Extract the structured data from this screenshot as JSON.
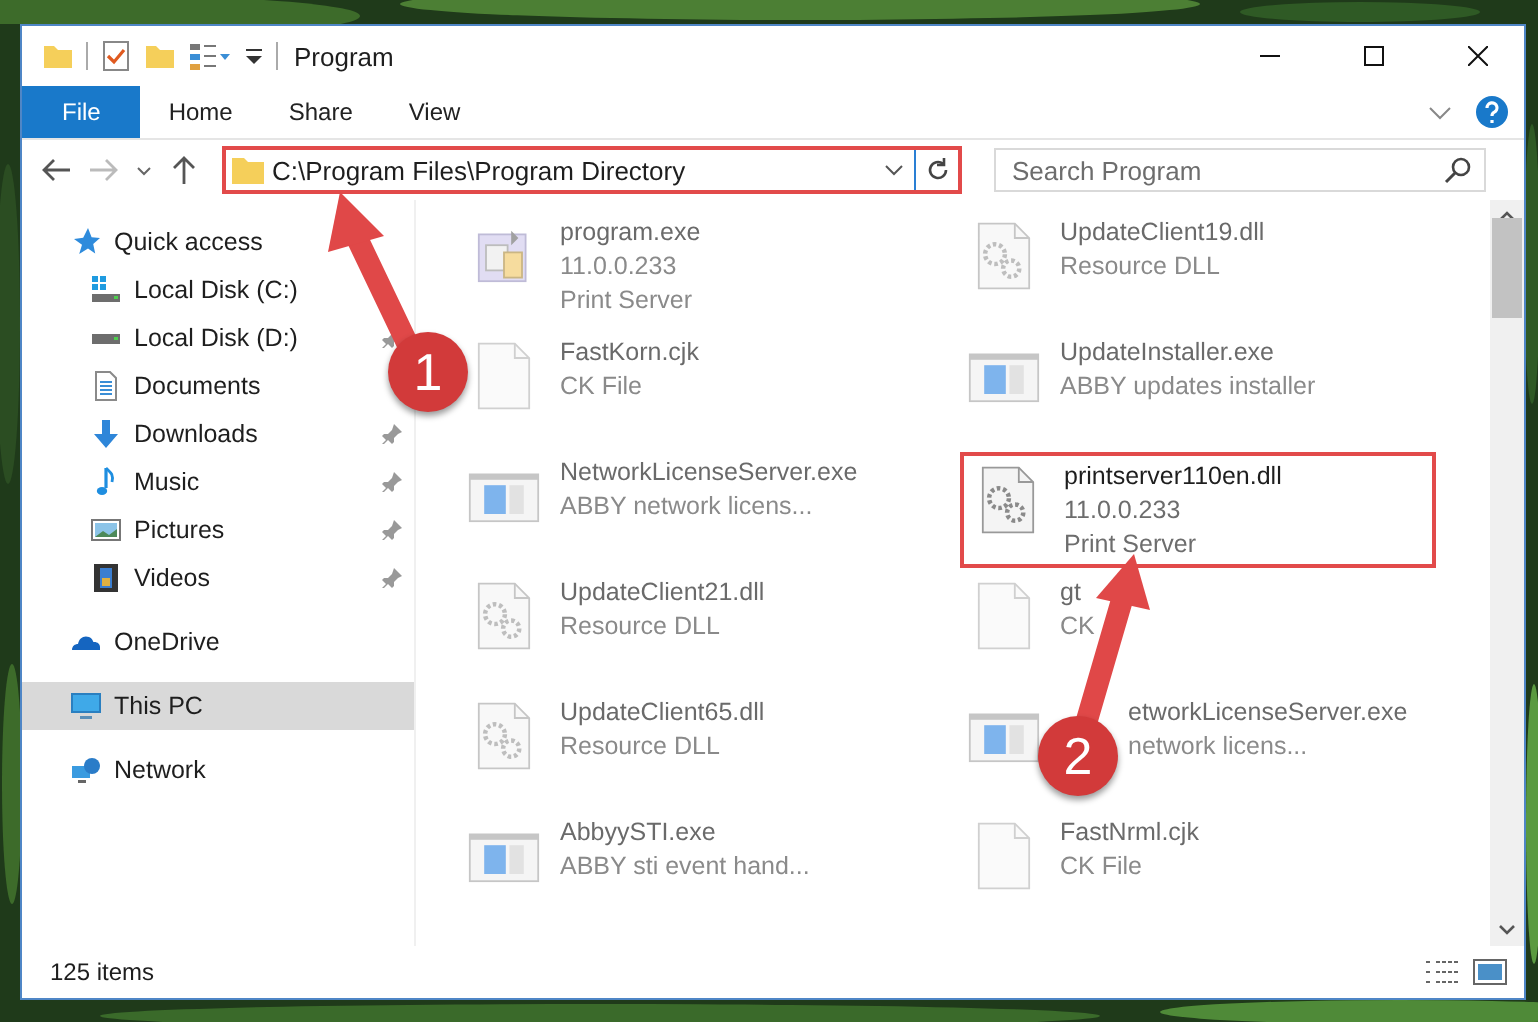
{
  "window": {
    "title": "Program"
  },
  "ribbon_tabs": [
    {
      "label": "File",
      "kind": "file"
    },
    {
      "label": "Home",
      "kind": "tab"
    },
    {
      "label": "Share",
      "kind": "tab"
    },
    {
      "label": "View",
      "kind": "tab"
    }
  ],
  "address": {
    "path": "C:\\Program Files\\Program Directory",
    "highlighted": true
  },
  "search": {
    "placeholder": "Search Program"
  },
  "sidebar": {
    "items": [
      {
        "label": "Quick access",
        "kind": "star",
        "selected": false,
        "children": [
          {
            "label": "Local Disk (C:)",
            "kind": "disk-c",
            "pinned": false,
            "selected": false
          },
          {
            "label": "Local Disk (D:)",
            "kind": "disk",
            "pinned": true,
            "selected": false
          },
          {
            "label": "Documents",
            "kind": "documents",
            "pinned": false,
            "selected": false
          },
          {
            "label": "Downloads",
            "kind": "downloads",
            "pinned": true,
            "selected": false
          },
          {
            "label": "Music",
            "kind": "music",
            "pinned": true,
            "selected": false
          },
          {
            "label": "Pictures",
            "kind": "pictures",
            "pinned": true,
            "selected": false
          },
          {
            "label": "Videos",
            "kind": "videos",
            "pinned": true,
            "selected": false
          }
        ]
      },
      {
        "label": "OneDrive",
        "kind": "cloud",
        "selected": false
      },
      {
        "label": "This PC",
        "kind": "pc",
        "selected": true
      },
      {
        "label": "Network",
        "kind": "network",
        "selected": false
      }
    ]
  },
  "files": [
    {
      "kind": "exe",
      "lines": [
        "program.exe",
        "11.0.0.233",
        "Print Server"
      ],
      "blurred": true,
      "highlighted": false,
      "covered_start": false
    },
    {
      "kind": "dll",
      "lines": [
        "UpdateClient19.dll",
        "Resource DLL"
      ],
      "blurred": true,
      "highlighted": false,
      "covered_start": false
    },
    {
      "kind": "file",
      "lines": [
        "FastKorn.cjk",
        "CK File"
      ],
      "blurred": true,
      "highlighted": false,
      "covered_start": false
    },
    {
      "kind": "app",
      "lines": [
        "UpdateInstaller.exe",
        "ABBY updates installer"
      ],
      "blurred": true,
      "highlighted": false,
      "covered_start": false
    },
    {
      "kind": "app",
      "lines": [
        "NetworkLicenseServer.exe",
        "ABBY network licens..."
      ],
      "blurred": true,
      "highlighted": false,
      "covered_start": false
    },
    {
      "kind": "dll",
      "lines": [
        "printserver110en.dll",
        "11.0.0.233",
        "Print Server"
      ],
      "blurred": false,
      "highlighted": true,
      "covered_start": false
    },
    {
      "kind": "dll",
      "lines": [
        "UpdateClient21.dll",
        "Resource DLL"
      ],
      "blurred": true,
      "highlighted": false,
      "covered_start": false
    },
    {
      "kind": "file",
      "lines": [
        "gt",
        "CK"
      ],
      "blurred": true,
      "highlighted": false,
      "covered_start": false
    },
    {
      "kind": "dll",
      "lines": [
        "UpdateClient65.dll",
        "Resource DLL"
      ],
      "blurred": true,
      "highlighted": false,
      "covered_start": false
    },
    {
      "kind": "app",
      "lines": [
        "etworkLicenseServer.exe",
        "network licens..."
      ],
      "blurred": true,
      "highlighted": false,
      "covered_start": true
    },
    {
      "kind": "app",
      "lines": [
        "AbbyySTI.exe",
        "ABBY sti event hand..."
      ],
      "blurred": true,
      "highlighted": false,
      "covered_start": false
    },
    {
      "kind": "file",
      "lines": [
        "FastNrml.cjk",
        "CK File"
      ],
      "blurred": true,
      "highlighted": false,
      "covered_start": false
    }
  ],
  "status_bar": {
    "count": "125 items"
  },
  "annotations": [
    {
      "label": "1"
    },
    {
      "label": "2"
    }
  ]
}
